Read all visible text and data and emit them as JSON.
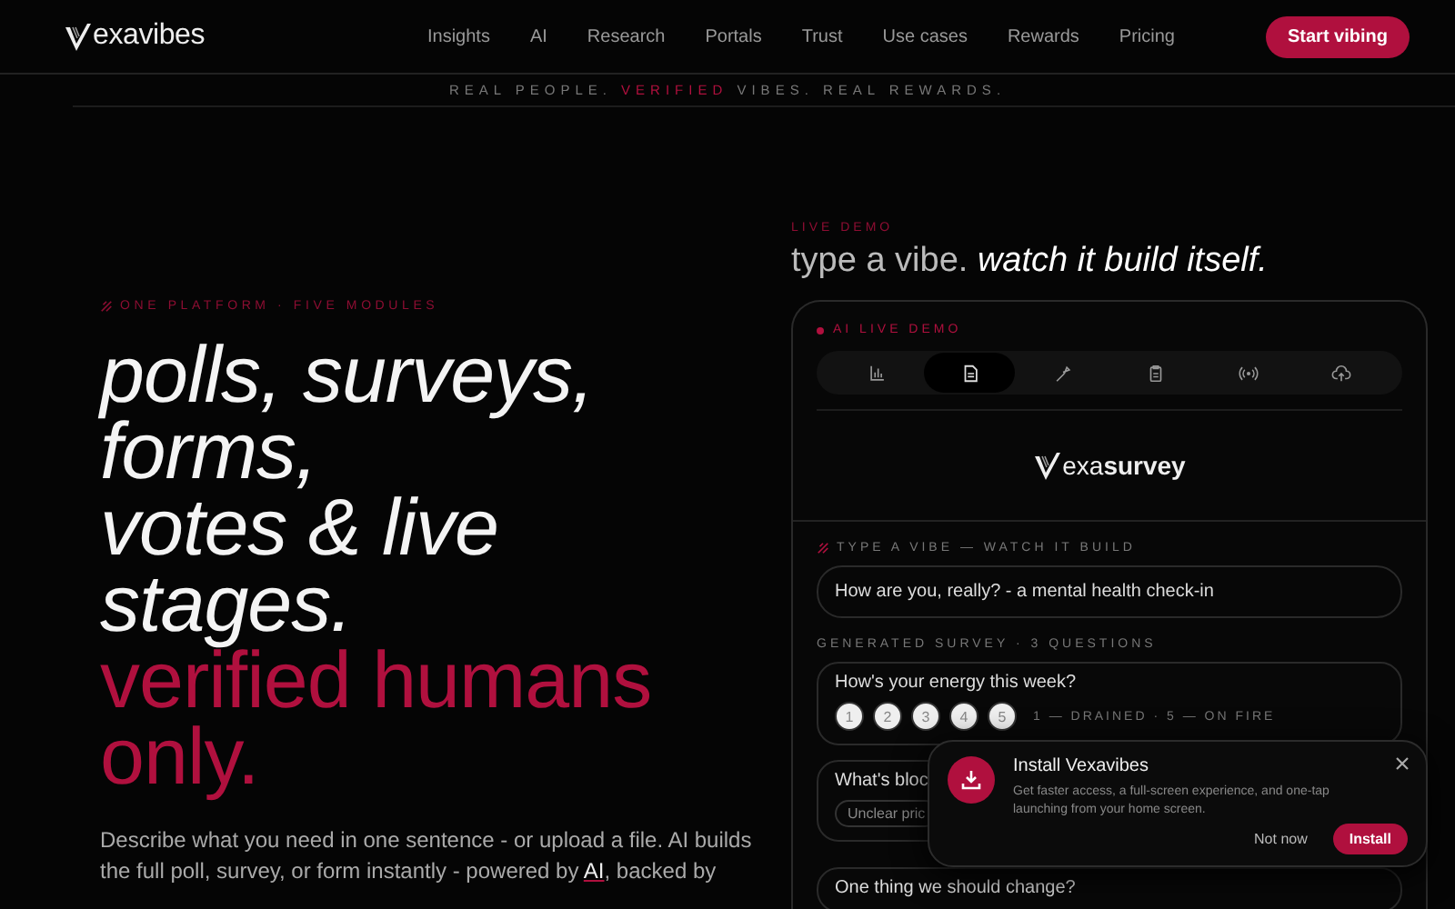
{
  "nav": {
    "logo": "exavibes",
    "links": [
      {
        "label": "Insights"
      },
      {
        "label": "AI"
      },
      {
        "label": "Research"
      },
      {
        "label": "Portals"
      },
      {
        "label": "Trust"
      },
      {
        "label": "Use cases"
      },
      {
        "label": "Rewards"
      },
      {
        "label": "Pricing"
      }
    ],
    "cta": "Start vibing"
  },
  "tagline": [
    "REAL PEOPLE. ",
    "VERIFIED",
    " VIBES. REAL REWARDS."
  ],
  "hero": {
    "eyebrow": "ONE PLATFORM · FIVE MODULES",
    "headline": [
      "polls, surveys,",
      "forms,",
      "votes & live",
      "stages."
    ],
    "accent": [
      "verified humans",
      "only."
    ],
    "paragraph": {
      "before": "Describe what you need in one sentence - or upload a file. AI builds the full poll, survey, or form instantly - powered by ",
      "link": "AI",
      "after": ", backed by"
    }
  },
  "demo": {
    "eyebrow": "LIVE DEMO",
    "title": "type a vibe.",
    "title_em": "watch it build itself.",
    "badge": "AI LIVE DEMO",
    "tabs": [
      {
        "kind": "chart",
        "selected": false
      },
      {
        "kind": "document",
        "selected": true
      },
      {
        "kind": "wand",
        "selected": false
      },
      {
        "kind": "clipboard",
        "selected": false
      },
      {
        "kind": "broadcast",
        "selected": false
      },
      {
        "kind": "upload",
        "selected": false
      }
    ],
    "product": "exa**survey**",
    "prompt_label": "TYPE A VIBE — WATCH IT BUILD",
    "prompt": "How are you, really? - a mental health check-in",
    "generated_label": "GENERATED SURVEY · 3 QUESTIONS",
    "questions": [
      {
        "kind": "scale",
        "text": "How's your energy this week?",
        "options": [
          "1",
          "2",
          "3",
          "4",
          "5"
        ],
        "legend": "1 — DRAINED · 5 — ON FIRE"
      },
      {
        "kind": "choice",
        "text": "What's bloc",
        "options": [
          "Unclear pric"
        ]
      },
      {
        "kind": "text",
        "text": "One thing we should change?"
      }
    ]
  },
  "popup": {
    "title": "Install Vexavibes",
    "body": "Get faster access, a full-screen experience, and one-tap launching from your home screen.",
    "dismiss": "Not now",
    "confirm": "Install"
  }
}
